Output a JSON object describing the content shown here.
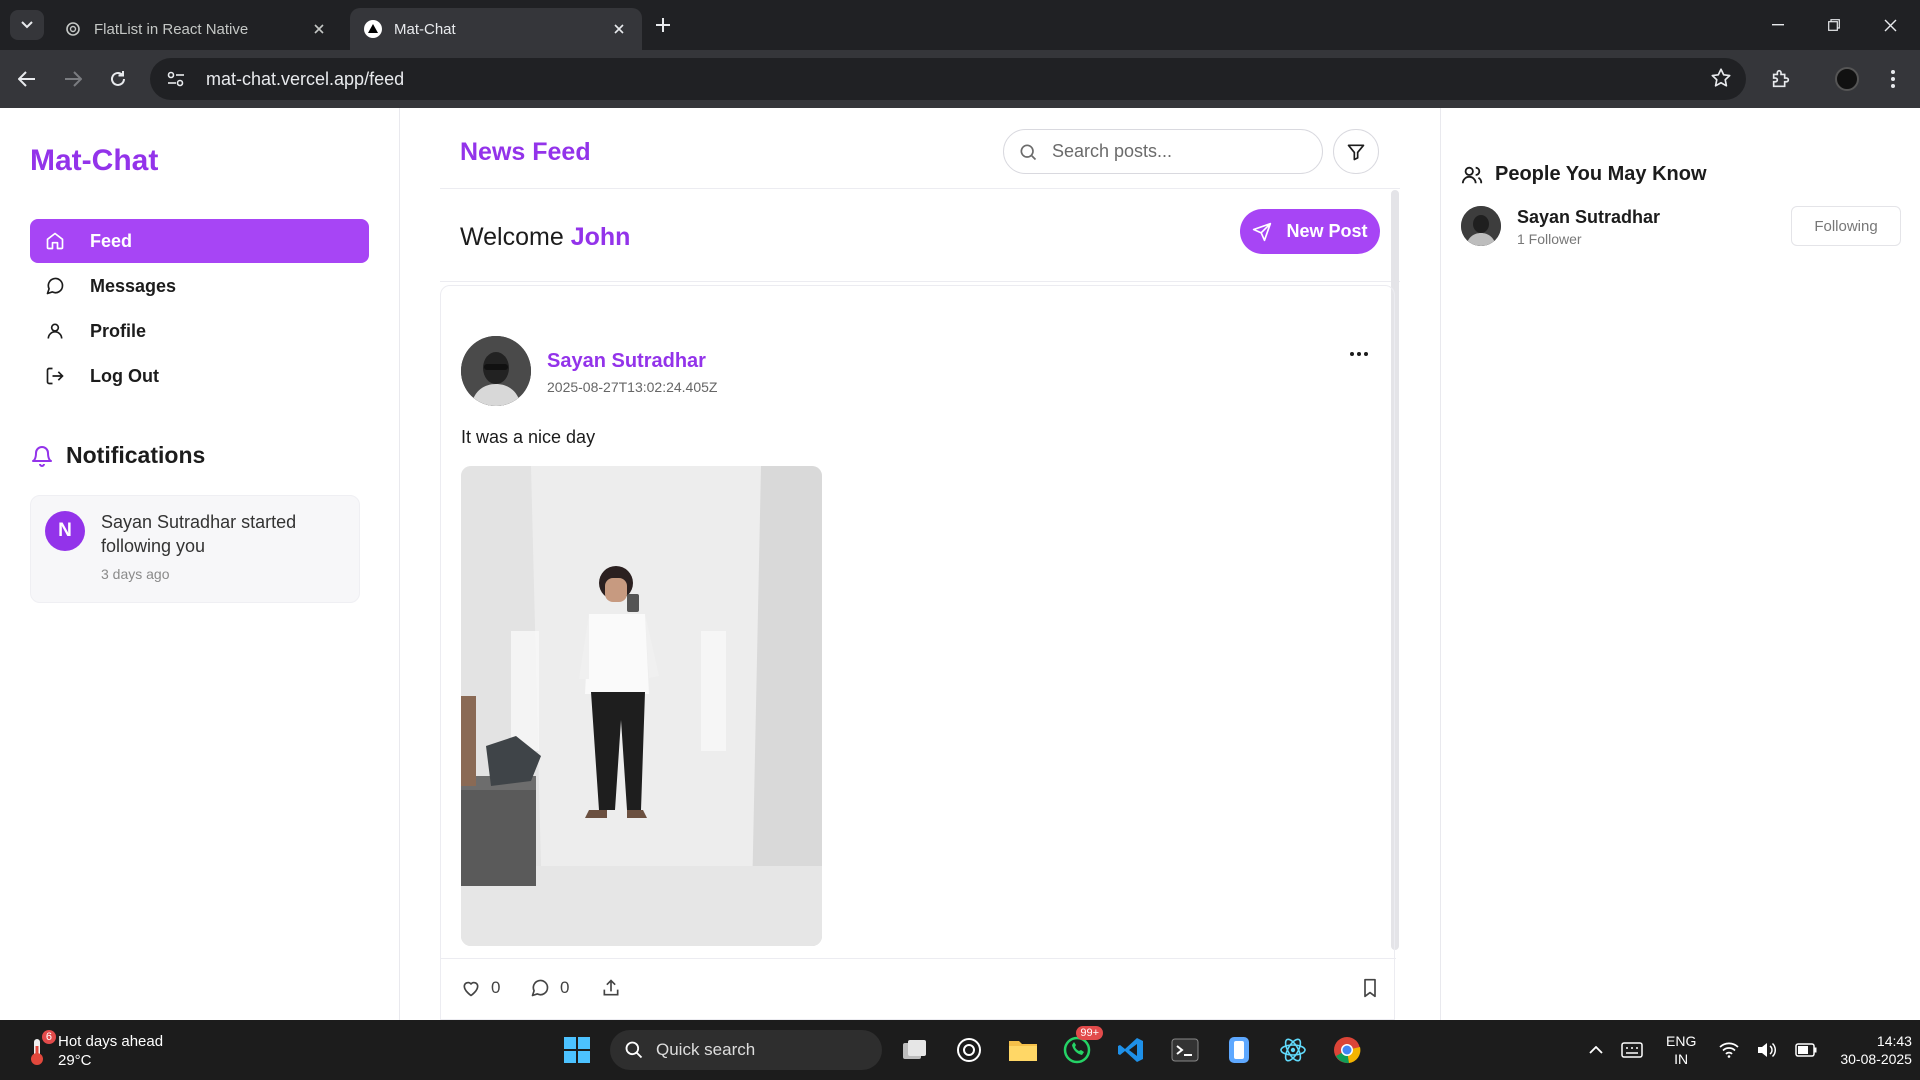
{
  "browser": {
    "tabs": [
      {
        "title": "FlatList in React Native",
        "active": false
      },
      {
        "title": "Mat-Chat",
        "active": true
      }
    ],
    "url": "mat-chat.vercel.app/feed"
  },
  "sidebar": {
    "brand": "Mat-Chat",
    "nav": [
      {
        "label": "Feed",
        "icon": "home-icon",
        "active": true
      },
      {
        "label": "Messages",
        "icon": "message-icon",
        "active": false
      },
      {
        "label": "Profile",
        "icon": "user-icon",
        "active": false
      },
      {
        "label": "Log Out",
        "icon": "logout-icon",
        "active": false
      }
    ],
    "notifications_title": "Notifications",
    "notifications": [
      {
        "avatar_letter": "N",
        "text": "Sayan Sutradhar started following you",
        "time": "3 days ago"
      }
    ]
  },
  "feed": {
    "title": "News Feed",
    "search_placeholder": "Search posts...",
    "welcome_prefix": "Welcome",
    "user_name": "John",
    "new_post_label": "New Post",
    "post": {
      "author": "Sayan Sutradhar",
      "timestamp": "2025-08-27T13:02:24.405Z",
      "text": "It was a nice day",
      "likes": "0",
      "comments": "0"
    }
  },
  "suggestions": {
    "title": "People You May Know",
    "people": [
      {
        "name": "Sayan Sutradhar",
        "followers": "1 Follower",
        "button": "Following"
      }
    ]
  },
  "taskbar": {
    "weather_title": "Hot days ahead",
    "weather_temp": "29°C",
    "weather_badge": "6",
    "search_label": "Quick search",
    "whatsapp_badge": "99+",
    "lang_top": "ENG",
    "lang_bottom": "IN",
    "time": "14:43",
    "date": "30-08-2025"
  },
  "colors": {
    "accent": "#9333ea",
    "accent_button": "#a745f5"
  }
}
